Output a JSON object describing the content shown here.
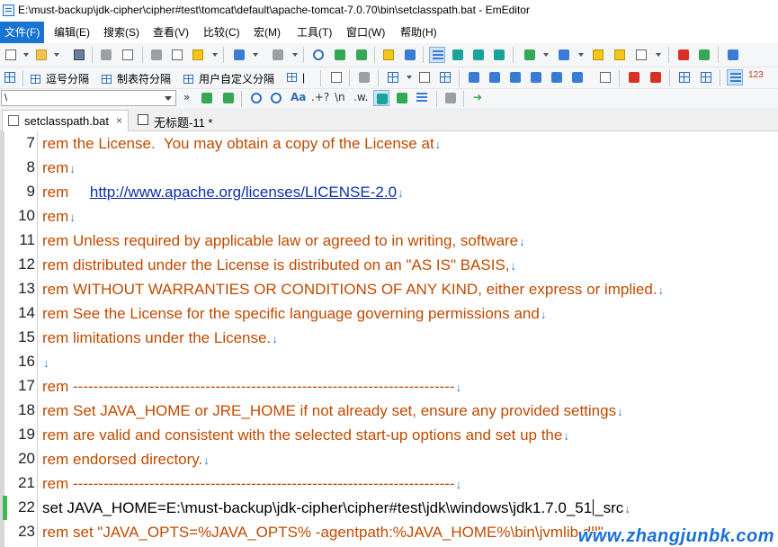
{
  "window": {
    "title": "E:\\must-backup\\jdk-cipher\\cipher#test\\tomcat\\default\\apache-tomcat-7.0.70\\bin\\setclasspath.bat - EmEditor"
  },
  "menu": [
    {
      "label": "文件(F)",
      "active": true
    },
    {
      "label": "编辑(E)"
    },
    {
      "label": "搜索(S)"
    },
    {
      "label": "查看(V)"
    },
    {
      "label": "比较(C)"
    },
    {
      "label": "宏(M)"
    },
    {
      "label": "工具(T)"
    },
    {
      "label": "窗口(W)"
    },
    {
      "label": "帮助(H)"
    }
  ],
  "toolbar2": {
    "comma_sep": "逗号分隔",
    "tab_sep": "制表符分隔",
    "custom_sep": "用户自定义分隔",
    "pipe": "|",
    "sort_glyph": "123"
  },
  "find_bar": {
    "value": "\\",
    "glyph_regex": ".+?",
    "glyph_newline": "\\n",
    "glyph_word": ".w."
  },
  "tabs": [
    {
      "label": "setclasspath.bat",
      "active": true,
      "close": "×"
    },
    {
      "label": "无标题-11 *",
      "active": false
    }
  ],
  "editor": {
    "eol_mark": "↓",
    "lines": [
      {
        "num": "7",
        "text": "rem the License.  You may obtain a copy of the License at",
        "style": "comment"
      },
      {
        "num": "8",
        "text": "rem",
        "style": "comment"
      },
      {
        "num": "9",
        "text": "rem     ",
        "link": "http://www.apache.org/licenses/LICENSE-2.0",
        "style": "comment"
      },
      {
        "num": "10",
        "text": "rem",
        "style": "comment"
      },
      {
        "num": "11",
        "text": "rem Unless required by applicable law or agreed to in writing, software",
        "style": "comment"
      },
      {
        "num": "12",
        "text": "rem distributed under the License is distributed on an \"AS IS\" BASIS,",
        "style": "comment"
      },
      {
        "num": "13",
        "text": "rem WITHOUT WARRANTIES OR CONDITIONS OF ANY KIND, either express or implied.",
        "style": "comment"
      },
      {
        "num": "14",
        "text": "rem See the License for the specific language governing permissions and",
        "style": "comment"
      },
      {
        "num": "15",
        "text": "rem limitations under the License.",
        "style": "comment"
      },
      {
        "num": "16",
        "text": "",
        "style": "comment"
      },
      {
        "num": "17",
        "text": "rem ---------------------------------------------------------------------------",
        "style": "comment"
      },
      {
        "num": "18",
        "text": "rem Set JAVA_HOME or JRE_HOME if not already set, ensure any provided settings",
        "style": "comment"
      },
      {
        "num": "19",
        "text": "rem are valid and consistent with the selected start-up options and set up the",
        "style": "comment"
      },
      {
        "num": "20",
        "text": "rem endorsed directory.",
        "style": "comment"
      },
      {
        "num": "21",
        "text": "rem ---------------------------------------------------------------------------",
        "style": "comment"
      },
      {
        "num": "22",
        "text": "set JAVA_HOME=E:\\must-backup\\jdk-cipher\\cipher#test\\jdk\\windows\\jdk1.7.0_51",
        "text_after": "_src",
        "style": "plain",
        "modified": true,
        "caret": true
      },
      {
        "num": "23",
        "text": "rem set \"JAVA_OPTS=%JAVA_OPTS% -agentpath:%JAVA_HOME%\\bin\\jvmlib.dll\"",
        "style": "comment"
      }
    ]
  },
  "watermark": "www.zhangjunbk.com",
  "colors": {
    "comment": "#c04a00",
    "link": "#0d2fa8",
    "eol": "#2a78d8",
    "menu_active": "#1874d1",
    "modified_marker": "#3cba54"
  }
}
